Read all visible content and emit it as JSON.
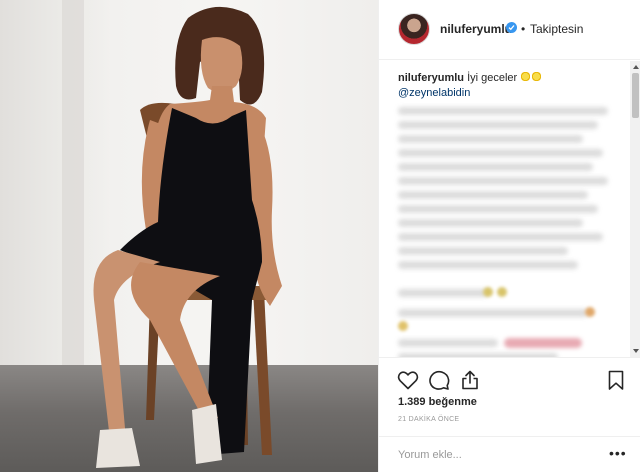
{
  "post": {
    "username": "niluferyumlu",
    "follow_status": "Takiptesin",
    "follow_separator": "•",
    "caption_username": "niluferyumlu",
    "caption_text": "İyi geceler",
    "caption_mention": "@zeynelabidin",
    "likes": "1.389 beğenme",
    "timestamp": "21 DAKİKA ÖNCE",
    "comment_placeholder": "Yorum ekle...",
    "more_label": "•••"
  },
  "icons": {
    "verified": "verified-badge-icon",
    "like": "heart-icon",
    "comment": "comment-bubble-icon",
    "share": "share-icon",
    "save": "bookmark-icon",
    "caption_emoji": "sun-face-emoji"
  },
  "colors": {
    "verified_blue": "#3897f0",
    "mention_link": "#003569",
    "muted_text": "#999999",
    "border": "#efefef",
    "dress": "#0e0e12"
  }
}
